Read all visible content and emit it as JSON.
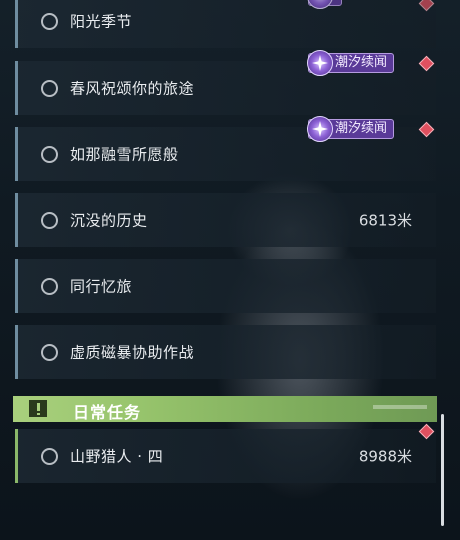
{
  "quests": [
    {
      "title": "阳光季节",
      "distance": "",
      "badge": ""
    },
    {
      "title": "春风祝颂你的旅途",
      "distance": "",
      "badge": "潮汐续闻"
    },
    {
      "title": "如那融雪所愿般",
      "distance": "",
      "badge": "潮汐续闻"
    },
    {
      "title": "沉没的历史",
      "distance": "6813米",
      "badge": ""
    },
    {
      "title": "同行忆旅",
      "distance": "",
      "badge": ""
    },
    {
      "title": "虚质磁暴协助作战",
      "distance": "",
      "badge": ""
    }
  ],
  "daily_section": {
    "title": "日常任务",
    "quests": [
      {
        "title": "山野猎人 · 四",
        "distance": "8988米"
      }
    ]
  },
  "colors": {
    "badge_purple": "#5a3a98",
    "daily_green": "#a9d07d",
    "marker_red": "#e0505f"
  },
  "icons": {
    "quest_status": "radio-circle-icon",
    "badge": "sparkle-icon",
    "tracking": "diamond-marker-icon",
    "section": "exclamation-icon"
  }
}
